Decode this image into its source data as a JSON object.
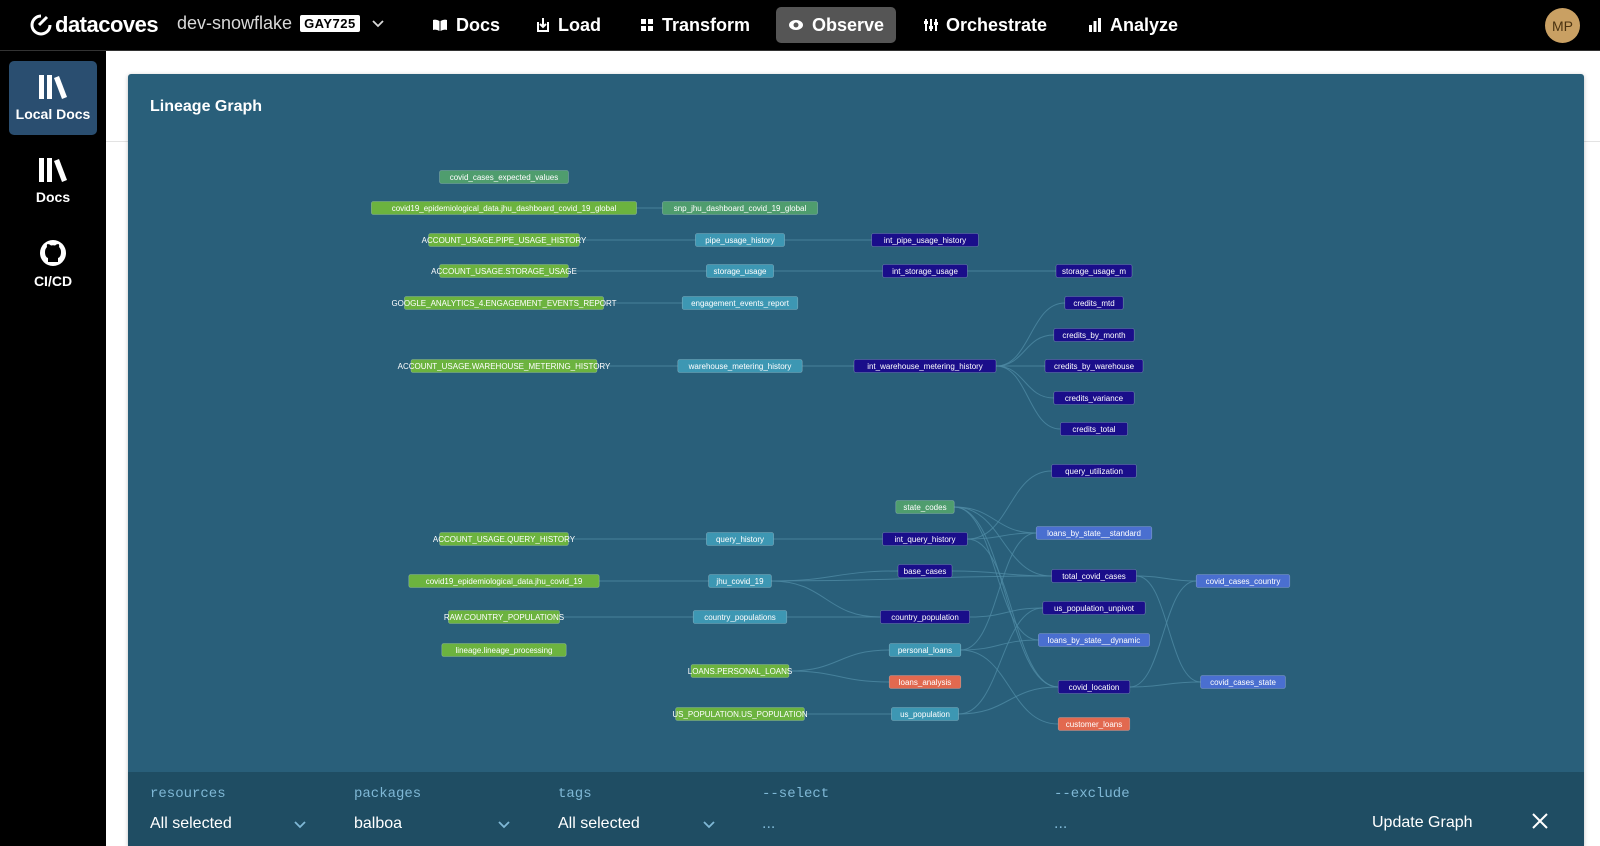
{
  "brand": {
    "name": "datacoves"
  },
  "env": {
    "name": "dev-snowflake",
    "badge": "GAY725"
  },
  "nav": [
    {
      "label": "Docs",
      "icon": "book-open-icon"
    },
    {
      "label": "Load",
      "icon": "load-icon"
    },
    {
      "label": "Transform",
      "icon": "transform-icon"
    },
    {
      "label": "Observe",
      "icon": "eye-icon",
      "active": true
    },
    {
      "label": "Orchestrate",
      "icon": "orchestrate-icon"
    },
    {
      "label": "Analyze",
      "icon": "analyze-icon"
    }
  ],
  "user": {
    "initials": "MP"
  },
  "sidebar": [
    {
      "label": "Local Docs",
      "icon": "library-icon",
      "active": true
    },
    {
      "label": "Docs",
      "icon": "library-icon"
    },
    {
      "label": "CI/CD",
      "icon": "github-icon"
    }
  ],
  "panel": {
    "title": "Lineage Graph"
  },
  "colors": {
    "source": "#6cb33f",
    "seed": "#4f9d6e",
    "staging": "#3d97b3",
    "intermediate": "#1a0e8a",
    "mart": "#4a6fd0",
    "analysis": "#e2694f",
    "background": "#295f7a",
    "edge": "#4d8aa4"
  },
  "nodes": [
    {
      "id": "n1",
      "label": "covid_cases_expected_values",
      "type": "seed"
    },
    {
      "id": "n2",
      "label": "covid19_epidemiological_data.jhu_dashboard_covid_19_global",
      "type": "source"
    },
    {
      "id": "n3",
      "label": "snp_jhu_dashboard_covid_19_global",
      "type": "seed"
    },
    {
      "id": "n4",
      "label": "ACCOUNT_USAGE.PIPE_USAGE_HISTORY",
      "type": "source"
    },
    {
      "id": "n5",
      "label": "pipe_usage_history",
      "type": "staging"
    },
    {
      "id": "n6",
      "label": "int_pipe_usage_history",
      "type": "intermediate"
    },
    {
      "id": "n7",
      "label": "ACCOUNT_USAGE.STORAGE_USAGE",
      "type": "source"
    },
    {
      "id": "n8",
      "label": "storage_usage",
      "type": "staging"
    },
    {
      "id": "n9",
      "label": "int_storage_usage",
      "type": "intermediate"
    },
    {
      "id": "n10",
      "label": "storage_usage_m",
      "type": "intermediate"
    },
    {
      "id": "n11",
      "label": "GOOGLE_ANALYTICS_4.ENGAGEMENT_EVENTS_REPORT",
      "type": "source"
    },
    {
      "id": "n12",
      "label": "engagement_events_report",
      "type": "staging"
    },
    {
      "id": "n13",
      "label": "credits_mtd",
      "type": "intermediate"
    },
    {
      "id": "n14",
      "label": "credits_by_month",
      "type": "intermediate"
    },
    {
      "id": "n15",
      "label": "ACCOUNT_USAGE.WAREHOUSE_METERING_HISTORY",
      "type": "source"
    },
    {
      "id": "n16",
      "label": "warehouse_metering_history",
      "type": "staging"
    },
    {
      "id": "n17",
      "label": "int_warehouse_metering_history",
      "type": "intermediate"
    },
    {
      "id": "n18",
      "label": "credits_by_warehouse",
      "type": "intermediate"
    },
    {
      "id": "n19",
      "label": "credits_variance",
      "type": "intermediate"
    },
    {
      "id": "n20",
      "label": "credits_total",
      "type": "intermediate"
    },
    {
      "id": "n21",
      "label": "query_utilization",
      "type": "intermediate"
    },
    {
      "id": "n22",
      "label": "state_codes",
      "type": "seed"
    },
    {
      "id": "n23",
      "label": "loans_by_state__standard",
      "type": "mart"
    },
    {
      "id": "n24",
      "label": "ACCOUNT_USAGE.QUERY_HISTORY",
      "type": "source"
    },
    {
      "id": "n25",
      "label": "query_history",
      "type": "staging"
    },
    {
      "id": "n26",
      "label": "int_query_history",
      "type": "intermediate"
    },
    {
      "id": "n27",
      "label": "base_cases",
      "type": "intermediate"
    },
    {
      "id": "n28",
      "label": "total_covid_cases",
      "type": "intermediate"
    },
    {
      "id": "n29",
      "label": "covid19_epidemiological_data.jhu_covid_19",
      "type": "source"
    },
    {
      "id": "n30",
      "label": "jhu_covid_19",
      "type": "staging"
    },
    {
      "id": "n31",
      "label": "covid_cases_country",
      "type": "mart"
    },
    {
      "id": "n32",
      "label": "us_population_unpivot",
      "type": "intermediate"
    },
    {
      "id": "n33",
      "label": "RAW.COUNTRY_POPULATIONS",
      "type": "source"
    },
    {
      "id": "n34",
      "label": "country_populations",
      "type": "staging"
    },
    {
      "id": "n35",
      "label": "country_population",
      "type": "intermediate"
    },
    {
      "id": "n36",
      "label": "loans_by_state__dynamic",
      "type": "mart"
    },
    {
      "id": "n37",
      "label": "lineage.lineage_processing",
      "type": "source"
    },
    {
      "id": "n38",
      "label": "personal_loans",
      "type": "staging"
    },
    {
      "id": "n39",
      "label": "LOANS.PERSONAL_LOANS",
      "type": "source"
    },
    {
      "id": "n40",
      "label": "loans_analysis",
      "type": "analysis"
    },
    {
      "id": "n41",
      "label": "covid_location",
      "type": "intermediate"
    },
    {
      "id": "n42",
      "label": "covid_cases_state",
      "type": "mart"
    },
    {
      "id": "n43",
      "label": "US_POPULATION.US_POPULATION",
      "type": "source"
    },
    {
      "id": "n44",
      "label": "us_population",
      "type": "staging"
    },
    {
      "id": "n45",
      "label": "customer_loans",
      "type": "analysis"
    }
  ],
  "edges": [
    [
      "n2",
      "n3"
    ],
    [
      "n4",
      "n5"
    ],
    [
      "n5",
      "n6"
    ],
    [
      "n7",
      "n8"
    ],
    [
      "n8",
      "n9"
    ],
    [
      "n9",
      "n10"
    ],
    [
      "n11",
      "n12"
    ],
    [
      "n15",
      "n16"
    ],
    [
      "n16",
      "n17"
    ],
    [
      "n17",
      "n13"
    ],
    [
      "n17",
      "n14"
    ],
    [
      "n17",
      "n18"
    ],
    [
      "n17",
      "n19"
    ],
    [
      "n17",
      "n20"
    ],
    [
      "n24",
      "n25"
    ],
    [
      "n25",
      "n26"
    ],
    [
      "n26",
      "n21"
    ],
    [
      "n26",
      "n23"
    ],
    [
      "n22",
      "n23"
    ],
    [
      "n22",
      "n36"
    ],
    [
      "n22",
      "n28"
    ],
    [
      "n29",
      "n30"
    ],
    [
      "n30",
      "n27"
    ],
    [
      "n30",
      "n35"
    ],
    [
      "n30",
      "n28"
    ],
    [
      "n27",
      "n28"
    ],
    [
      "n28",
      "n31"
    ],
    [
      "n28",
      "n42"
    ],
    [
      "n33",
      "n34"
    ],
    [
      "n34",
      "n35"
    ],
    [
      "n35",
      "n32"
    ],
    [
      "n44",
      "n32"
    ],
    [
      "n43",
      "n44"
    ],
    [
      "n39",
      "n38"
    ],
    [
      "n39",
      "n40"
    ],
    [
      "n38",
      "n23"
    ],
    [
      "n38",
      "n36"
    ],
    [
      "n38",
      "n45"
    ],
    [
      "n22",
      "n41"
    ],
    [
      "n41",
      "n31"
    ],
    [
      "n41",
      "n42"
    ],
    [
      "n26",
      "n41"
    ],
    [
      "n44",
      "n41"
    ]
  ],
  "filters": {
    "resources": {
      "label": "resources",
      "value": "All selected"
    },
    "packages": {
      "label": "packages",
      "value": "balboa"
    },
    "tags": {
      "label": "tags",
      "value": "All selected"
    },
    "select": {
      "label": "--select",
      "placeholder": "..."
    },
    "exclude": {
      "label": "--exclude",
      "placeholder": "..."
    },
    "update_label": "Update Graph"
  }
}
